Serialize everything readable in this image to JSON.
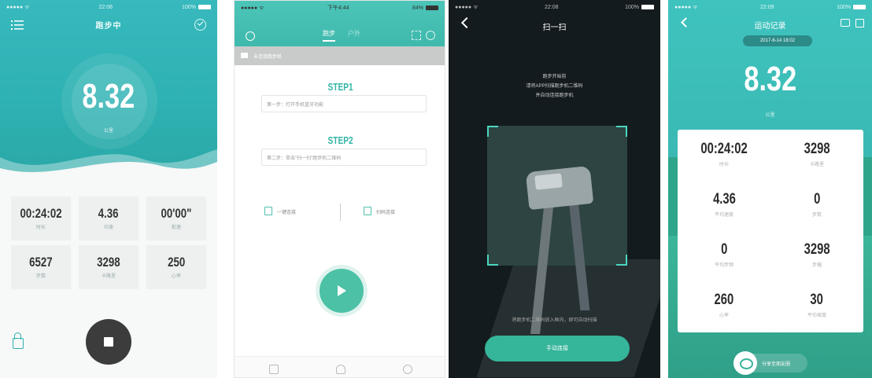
{
  "screen1": {
    "title": "跑步中",
    "distance": "8.32",
    "distance_unit": "公里",
    "stats": [
      {
        "value": "00:24:02",
        "label": "时长"
      },
      {
        "value": "4.36",
        "label": "均速"
      },
      {
        "value": "00'00\"",
        "label": "配速"
      },
      {
        "value": "6527",
        "label": "步数"
      },
      {
        "value": "3298",
        "label": "卡路里"
      },
      {
        "value": "250",
        "label": "心率"
      }
    ]
  },
  "screen2": {
    "tabs": [
      "跑步",
      "户外"
    ],
    "notice": "未连接跑步机",
    "step1_title": "STEP1",
    "step1_text": "第一步：打开手机蓝牙功能",
    "step2_title": "STEP2",
    "step2_text": "第二步：单击\"扫一扫\"跑步机二维码",
    "option_left": "一键连接",
    "option_right": "扫码连接"
  },
  "screen3": {
    "title": "扫一扫",
    "hint_lines": [
      "跑步开始前",
      "请将APP扫描跑步机二维码",
      "并自动连接跑步机"
    ],
    "footnote": "将跑步机二维码放入框内，即可自动扫描",
    "manual_button": "手动连接"
  },
  "screen4": {
    "title": "运动记录",
    "date": "2017-6-14 18:02",
    "distance": "8.32",
    "distance_unit": "公里",
    "stats": [
      {
        "value": "00:24:02",
        "label": "时长"
      },
      {
        "value": "3298",
        "label": "卡路里"
      },
      {
        "value": "4.36",
        "label": "平均速度"
      },
      {
        "value": "0",
        "label": "步数"
      },
      {
        "value": "0",
        "label": "平均步频"
      },
      {
        "value": "3298",
        "label": "步幅"
      },
      {
        "value": "260",
        "label": "心率"
      },
      {
        "value": "30",
        "label": "平均坡度"
      }
    ],
    "share_label": "分享至朋友圈"
  }
}
